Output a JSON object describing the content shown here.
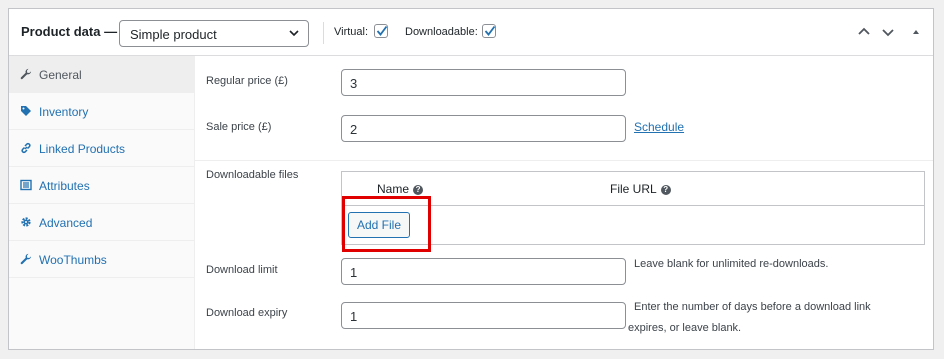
{
  "header": {
    "title": "Product data —",
    "product_type": "Simple product",
    "virtual_label": "Virtual:",
    "virtual_checked": true,
    "downloadable_label": "Downloadable:",
    "downloadable_checked": true,
    "controls": [
      "chevron-up-icon",
      "chevron-down-icon",
      "toggle-arrow-icon"
    ]
  },
  "sidebar": {
    "items": [
      {
        "label": "General",
        "icon": "wrench-icon",
        "active": true
      },
      {
        "label": "Inventory",
        "icon": "tag-icon",
        "active": false
      },
      {
        "label": "Linked Products",
        "icon": "link-icon",
        "active": false
      },
      {
        "label": "Attributes",
        "icon": "list-icon",
        "active": false
      },
      {
        "label": "Advanced",
        "icon": "gear-icon",
        "active": false
      },
      {
        "label": "WooThumbs",
        "icon": "wrench-icon",
        "active": false
      }
    ]
  },
  "main": {
    "regular_price": {
      "label": "Regular price (£)",
      "value": "3"
    },
    "sale_price": {
      "label": "Sale price (£)",
      "value": "2",
      "schedule_link": "Schedule"
    },
    "downloadable_files": {
      "label": "Downloadable files",
      "columns": [
        "Name",
        "File URL"
      ],
      "add_button": "Add File"
    },
    "download_limit": {
      "label": "Download limit",
      "value": "1",
      "description": "Leave blank for unlimited re-downloads."
    },
    "download_expiry": {
      "label": "Download expiry",
      "value": "1",
      "description_line1": "Enter the number of days before a download link",
      "description_line2": "expires, or leave blank."
    }
  },
  "colors": {
    "accent": "#2271b1",
    "highlight": "#e00000",
    "border": "#c3c4c7"
  }
}
